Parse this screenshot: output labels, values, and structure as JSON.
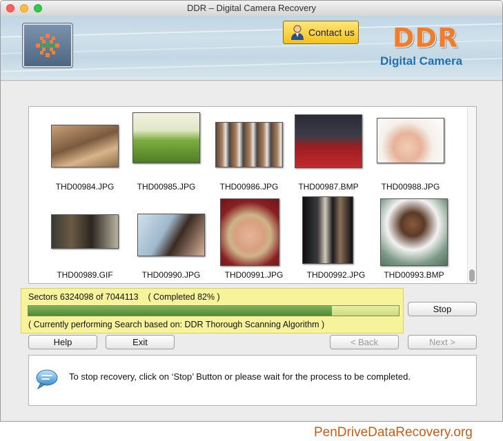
{
  "window": {
    "title": "DDR – Digital Camera Recovery"
  },
  "header": {
    "contact_label": "Contact us",
    "brand_name": "DDR",
    "brand_subtitle": "Digital Camera",
    "brand_color": "#ef7d2b",
    "subtitle_color": "#1f6fae"
  },
  "thumbnails": [
    {
      "name": "THD00984.JPG",
      "icon": "photo-woman-seated"
    },
    {
      "name": "THD00985.JPG",
      "icon": "photo-dog-on-grass"
    },
    {
      "name": "THD00986.JPG",
      "icon": "photo-group"
    },
    {
      "name": "THD00987.BMP",
      "icon": "photo-red-carpet"
    },
    {
      "name": "THD00988.JPG",
      "icon": "photo-baby-in-hat"
    },
    {
      "name": "THD00989.GIF",
      "icon": "photo-man-in-suit"
    },
    {
      "name": "THD00990.JPG",
      "icon": "photo-woman-smiling"
    },
    {
      "name": "THD00991.JPG",
      "icon": "photo-woman-portrait"
    },
    {
      "name": "THD00992.JPG",
      "icon": "photo-couple-night"
    },
    {
      "name": "THD00993.BMP",
      "icon": "photo-man-sunglasses"
    }
  ],
  "progress": {
    "sectors_text": "Sectors 6324098 of 7044113    ( Completed 82% )",
    "percent": 82,
    "algorithm_text": "( Currently performing Search based on: DDR Thorough Scanning Algorithm )"
  },
  "buttons": {
    "stop": "Stop",
    "help": "Help",
    "exit": "Exit",
    "back": "< Back",
    "next": "Next >"
  },
  "message": {
    "text": "To stop recovery, click on ‘Stop’ Button or please wait for the process to be completed."
  },
  "footer": {
    "link": "PenDriveDataRecovery.org"
  }
}
